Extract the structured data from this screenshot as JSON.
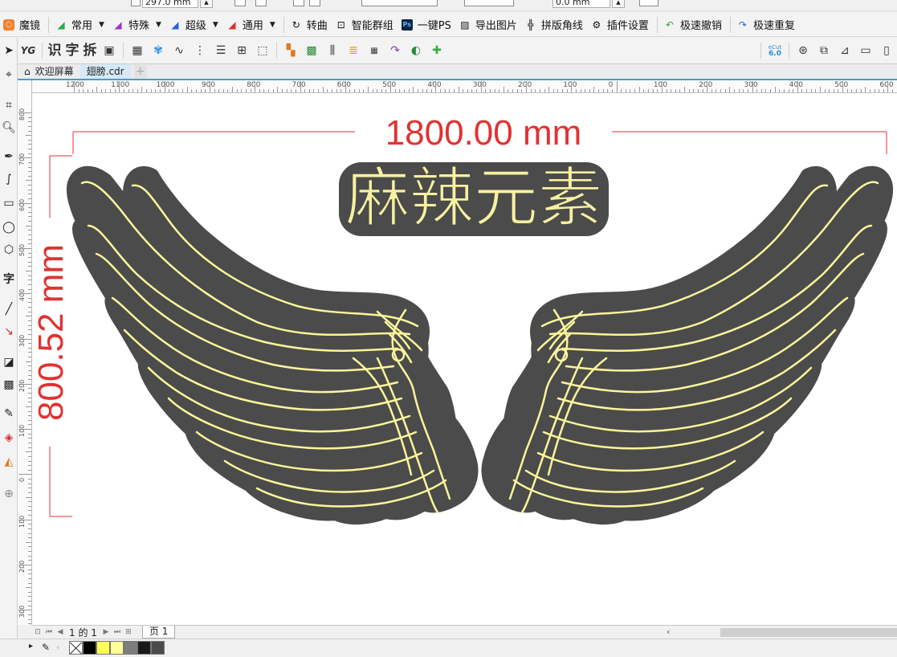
{
  "propbar": {
    "height_field": "297.0 mm",
    "offset_field": "0.0 mm"
  },
  "plugins": [
    {
      "name": "magic-mirror",
      "label": "魔镜",
      "icon": "orange-badge-icon",
      "dropdown": false
    },
    {
      "name": "common",
      "label": "常用",
      "icon": "green-arrow-icon",
      "dropdown": true
    },
    {
      "name": "special",
      "label": "特殊",
      "icon": "purple-arrow-icon",
      "dropdown": true
    },
    {
      "name": "super",
      "label": "超级",
      "icon": "blue-arrow-icon",
      "dropdown": true
    },
    {
      "name": "general",
      "label": "通用",
      "icon": "red-arrow-icon",
      "dropdown": true
    },
    {
      "name": "to-curve",
      "label": "转曲",
      "icon": "curve-icon",
      "dropdown": false
    },
    {
      "name": "smart-group",
      "label": "智能群组",
      "icon": "group-icon",
      "dropdown": false
    },
    {
      "name": "one-click-ps",
      "label": "一键PS",
      "icon": "ps-icon",
      "dropdown": false
    },
    {
      "name": "export-image",
      "label": "导出图片",
      "icon": "image-icon",
      "dropdown": false
    },
    {
      "name": "imposition-marks",
      "label": "拼版角线",
      "icon": "crop-marks-icon",
      "dropdown": false
    },
    {
      "name": "plugin-settings",
      "label": "插件设置",
      "icon": "gear-icon",
      "dropdown": false
    },
    {
      "name": "quick-undo",
      "label": "极速撤销",
      "icon": "undo-icon",
      "dropdown": false
    },
    {
      "name": "quick-redo",
      "label": "极速重复",
      "icon": "redo-icon",
      "dropdown": false
    }
  ],
  "iconbar": {
    "t1": "识",
    "t2": "字",
    "t3": "拆",
    "yg": "YG",
    "ecut": "eCut",
    "ecut_ver": "6.0"
  },
  "tabs": [
    {
      "label": "欢迎屏幕",
      "active": false
    },
    {
      "label": "翅膀.cdr",
      "active": true
    }
  ],
  "ruler": {
    "h_ticks": [
      "1200",
      "1100",
      "1000",
      "900",
      "800",
      "700",
      "600",
      "500",
      "400",
      "300",
      "200",
      "100",
      "0",
      "100",
      "200",
      "300",
      "400",
      "500",
      "600"
    ],
    "v_ticks": [
      "800",
      "700",
      "600",
      "500",
      "400",
      "300",
      "200",
      "100",
      "0",
      "100",
      "200",
      "300"
    ]
  },
  "design": {
    "width_dim": "1800.00 mm",
    "height_dim": "800.52 mm",
    "title": "麻辣元素",
    "colors": {
      "dim": "#e03232",
      "wing_fill": "#4b4b4b",
      "stroke": "#fbf59a",
      "text_fill": "#f7f0a0"
    }
  },
  "pagenav": {
    "page_of": "1 的 1",
    "page_tab": "页 1"
  },
  "palette": [
    "#ffffff",
    "#000000",
    "#ffff55",
    "#ffff99",
    "#7d7d7d",
    "#1a1a1a",
    "#4b4b4b"
  ]
}
